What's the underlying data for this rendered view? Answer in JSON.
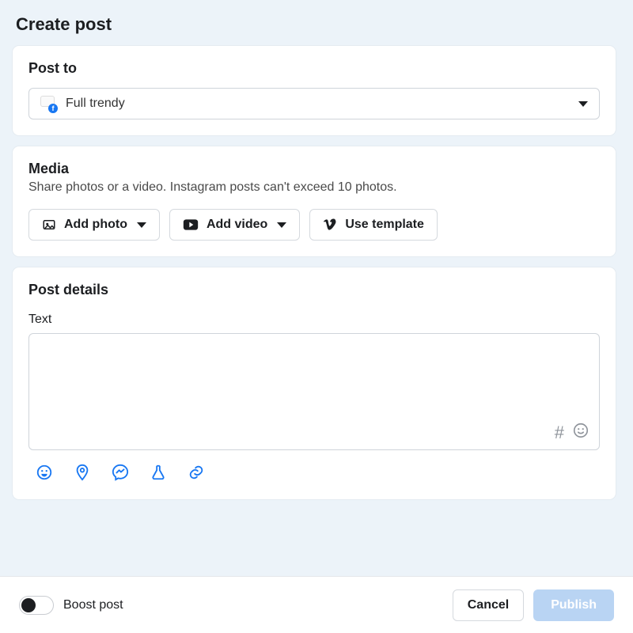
{
  "page": {
    "title": "Create post"
  },
  "post_to": {
    "heading": "Post to",
    "selected": "Full trendy"
  },
  "media": {
    "heading": "Media",
    "subtext": "Share photos or a video. Instagram posts can't exceed 10 photos.",
    "buttons": {
      "add_photo": "Add photo",
      "add_video": "Add video",
      "use_template": "Use template"
    }
  },
  "details": {
    "heading": "Post details",
    "text_label": "Text",
    "text_value": ""
  },
  "footer": {
    "boost_label": "Boost post",
    "cancel": "Cancel",
    "publish": "Publish"
  }
}
